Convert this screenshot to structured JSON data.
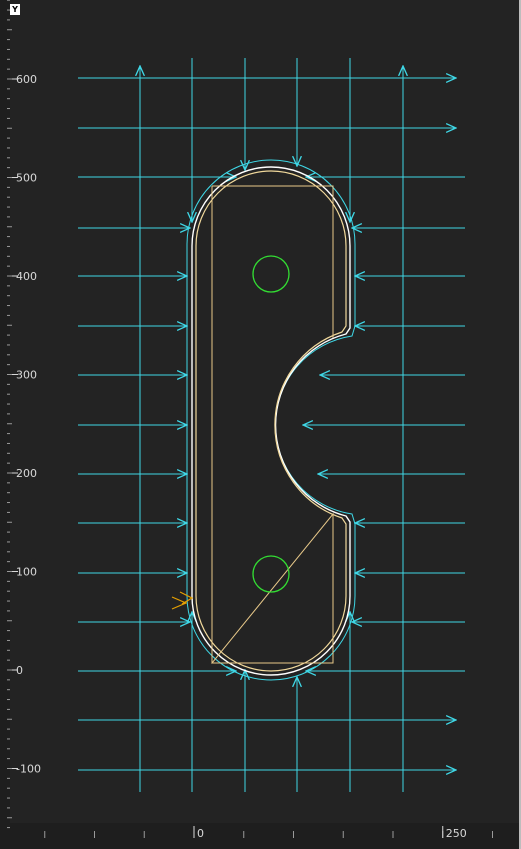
{
  "axis_badge": "Y",
  "y_ticks": [
    {
      "label": "600",
      "value": 600
    },
    {
      "label": "500",
      "value": 500
    },
    {
      "label": "400",
      "value": 400
    },
    {
      "label": "300",
      "value": 300
    },
    {
      "label": "200",
      "value": 200
    },
    {
      "label": "100",
      "value": 100
    },
    {
      "label": "0",
      "value": 0
    },
    {
      "label": "-100",
      "value": -100
    }
  ],
  "x_ticks": [
    {
      "label": "0",
      "value": 0
    },
    {
      "label": "250",
      "value": 250
    }
  ],
  "colors": {
    "background": "#232323",
    "guide_lines": "#3fd7e6",
    "part_outline": "#ffffff",
    "toolpath": "#f1d99c",
    "holes": "#33dd33",
    "start_marker": "#e6a000",
    "tick_text": "#d9d9d9"
  }
}
